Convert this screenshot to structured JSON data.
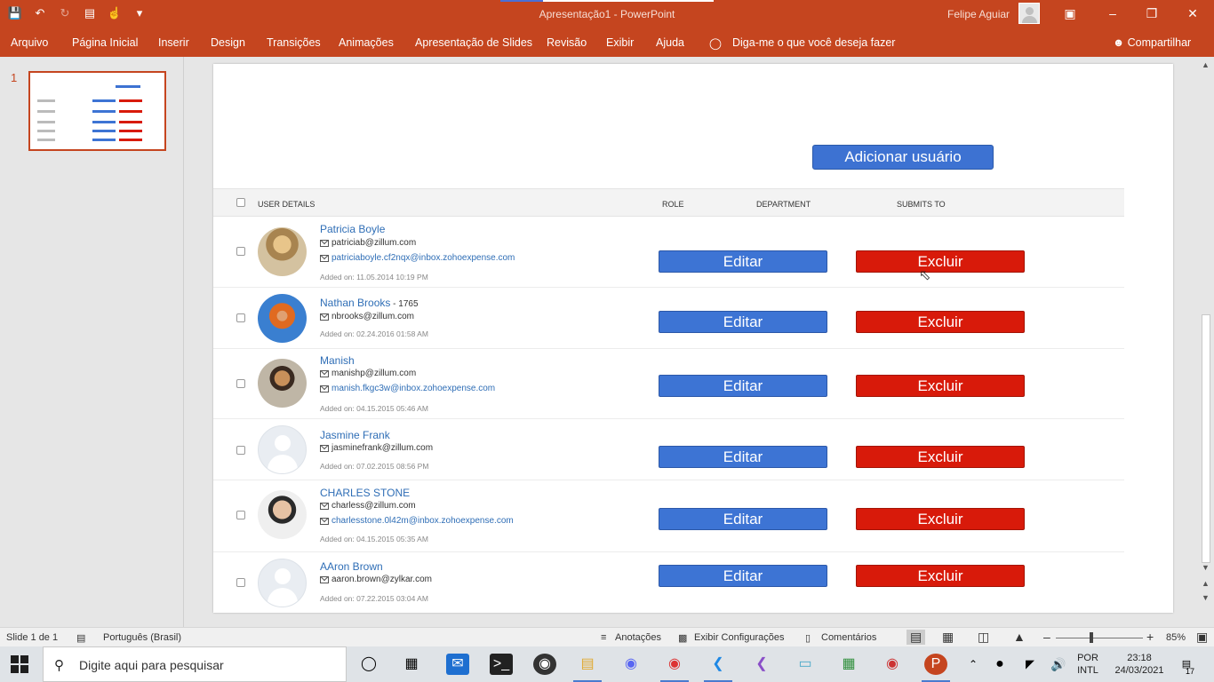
{
  "window": {
    "title": "Apresentação1  -  PowerPoint",
    "user": "Felipe Aguiar"
  },
  "ribbon": {
    "tabs": [
      "Arquivo",
      "Página Inicial",
      "Inserir",
      "Design",
      "Transições",
      "Animações",
      "Apresentação de Slides",
      "Revisão",
      "Exibir",
      "Ajuda"
    ],
    "tell_me": "Diga-me o que você deseja fazer",
    "share": "Compartilhar"
  },
  "thumbnails": {
    "slide_number": "1"
  },
  "slide": {
    "add_user_label": "Adicionar usuário",
    "headers": {
      "user_details": "USER DETAILS",
      "role": "ROLE",
      "department": "DEPARTMENT",
      "submits_to": "SUBMITS TO"
    },
    "edit_label": "Editar",
    "delete_label": "Excluir",
    "users": [
      {
        "name": "Patricia Boyle",
        "suffix": "",
        "email": "patriciab@zillum.com",
        "inbox": "patriciaboyle.cf2nqx@inbox.zohoexpense.com",
        "added": "Added on: 11.05.2014 10:19 PM",
        "avatar": "photo"
      },
      {
        "name": "Nathan Brooks",
        "suffix": " - 1765",
        "email": "nbrooks@zillum.com",
        "inbox": "",
        "added": "Added on: 02.24.2016 01:58 AM",
        "avatar": "photo"
      },
      {
        "name": "Manish",
        "suffix": "",
        "email": "manishp@zillum.com",
        "inbox": "manish.fkgc3w@inbox.zohoexpense.com",
        "added": "Added on: 04.15.2015 05:46 AM",
        "avatar": "photo"
      },
      {
        "name": "Jasmine Frank",
        "suffix": "",
        "email": "jasminefrank@zillum.com",
        "inbox": "",
        "added": "Added on: 07.02.2015 08:56 PM",
        "avatar": "placeholder"
      },
      {
        "name": "CHARLES STONE",
        "suffix": "",
        "email": "charless@zillum.com",
        "inbox": "charlesstone.0l42m@inbox.zohoexpense.com",
        "added": "Added on: 04.15.2015 05:35 AM",
        "avatar": "photo"
      },
      {
        "name": "AAron Brown",
        "suffix": "",
        "email": "aaron.brown@zylkar.com",
        "inbox": "",
        "added": "Added on: 07.22.2015 03:04 AM",
        "avatar": "placeholder"
      }
    ]
  },
  "statusbar": {
    "slide_of": "Slide 1 de 1",
    "language": "Português (Brasil)",
    "notes": "Anotações",
    "display_settings": "Exibir Configurações",
    "comments": "Comentários",
    "zoom": "85%"
  },
  "taskbar": {
    "search_placeholder": "Digite aqui para pesquisar",
    "lang_top": "POR",
    "lang_bottom": "INTL",
    "time": "23:18",
    "date": "24/03/2021",
    "notifications": "17"
  },
  "colors": {
    "accent": "#c5451f",
    "edit": "#3d74d4",
    "delete": "#d81a0a",
    "link": "#2f6eb6"
  }
}
